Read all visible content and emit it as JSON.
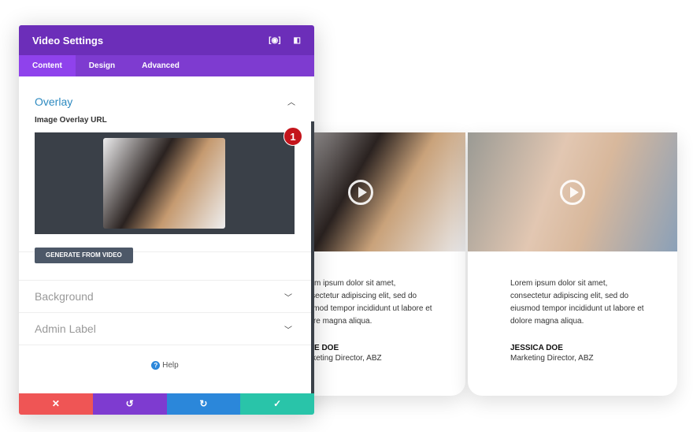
{
  "panel": {
    "title": "Video Settings",
    "tabs": [
      "Content",
      "Design",
      "Advanced"
    ],
    "overlay": {
      "title": "Overlay",
      "field_label": "Image Overlay URL",
      "generate_button": "GENERATE FROM VIDEO"
    },
    "sections": [
      "Background",
      "Admin Label"
    ],
    "help": "Help",
    "footer_colors": {
      "cancel": "#ef5555",
      "undo": "#7e3bd0",
      "redo": "#2b87da",
      "save": "#29c4a9"
    }
  },
  "badge": "1",
  "cards": [
    {
      "text": "Lorem ipsum dolor sit amet, consectetur adipiscing elit, sed do eiusmod tempor incididunt ut labore et dolore magna aliqua.",
      "name": "JANE DOE",
      "role": "Marketing Director, ABZ"
    },
    {
      "text": "Lorem ipsum dolor sit amet, consectetur adipiscing elit, sed do eiusmod tempor incididunt ut labore et dolore magna aliqua.",
      "name": "JESSICA DOE",
      "role": "Marketing Director, ABZ"
    }
  ]
}
